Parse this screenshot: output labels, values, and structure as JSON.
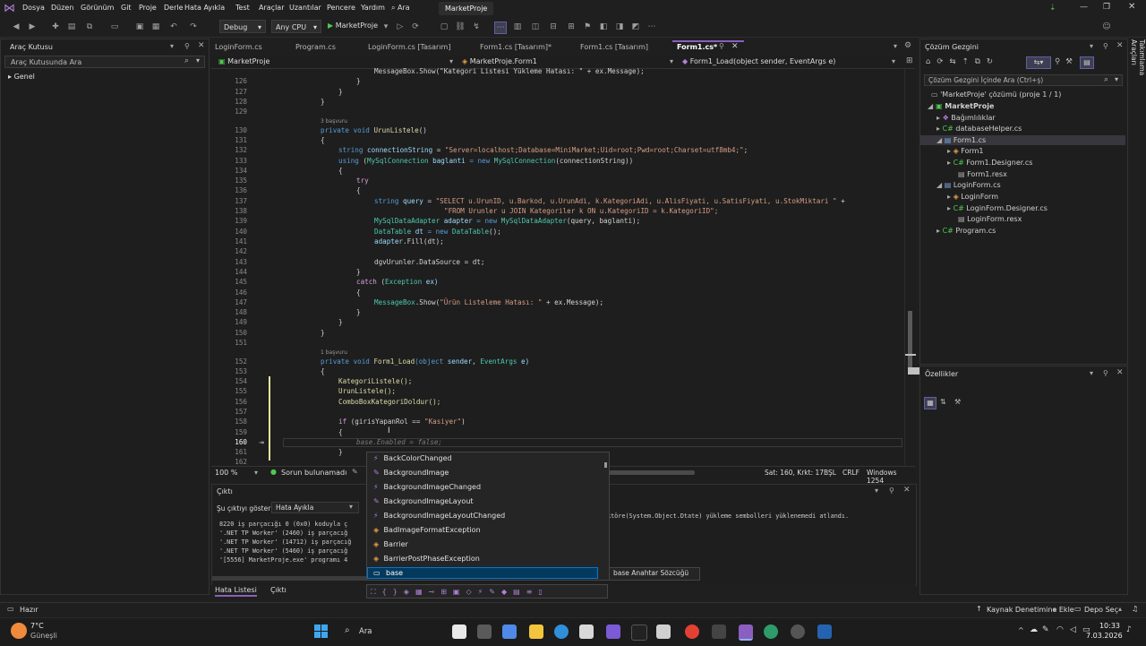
{
  "menubar": {
    "items": [
      "Dosya",
      "Düzen",
      "Görünüm",
      "Git",
      "Proje",
      "Derle",
      "Hata Ayıkla",
      "Test",
      "Araçlar",
      "Uzantılar",
      "Pencere",
      "Yardım"
    ],
    "search_label": "Ara",
    "solution_name": "MarketProje"
  },
  "toolbar": {
    "config": "Debug",
    "platform": "Any CPU",
    "run_label": "MarketProje"
  },
  "toolbox": {
    "title": "Araç Kutusu",
    "search_placeholder": "Araç Kutusunda Ara",
    "group": "Genel"
  },
  "tabs": [
    "LoginForm.cs",
    "Program.cs",
    "LoginForm.cs [Tasarım]",
    "Form1.cs [Tasarım]*",
    "Form1.cs [Tasarım]",
    "Form1.cs*"
  ],
  "navbar": {
    "project": "MarketProje",
    "class": "MarketProje.Form1",
    "member": "Form1_Load(object sender, EventArgs e)"
  },
  "editor": {
    "line_numbers": [
      "126",
      "127",
      "128",
      "129",
      "130",
      "131",
      "132",
      "133",
      "134",
      "135",
      "136",
      "137",
      "138",
      "139",
      "140",
      "141",
      "142",
      "143",
      "144",
      "145",
      "146",
      "147",
      "148",
      "149",
      "150",
      "151",
      "152",
      "153",
      "154",
      "155",
      "156",
      "157",
      "158",
      "159",
      "160",
      "161",
      "162"
    ],
    "ref_labels": [
      "3 başvuru",
      "1 başvuru"
    ],
    "lines": {
      "l125": "MessageBox.Show(\"Kategori Listesi Yükleme Hatası: \" + ex.Message);",
      "l126": "}",
      "l127": "}",
      "l128": "}",
      "l130a": "private void ",
      "l130b": "UrunListele",
      "l130c": "()",
      "l131": "{",
      "l132a": "string ",
      "l132b": "connectionString",
      "l132c": " = ",
      "l132d": "\"Server=localhost;Database=MiniMarket;Uid=root;Pwd=root;Charset=utf8mb4;\"",
      "l132e": ";",
      "l133a": "using ",
      "l133b": "(",
      "l133c": "MySqlConnection",
      "l133d": " baglanti",
      "l133e": " = new ",
      "l133f": "MySqlConnection",
      "l133g": "(connectionString))",
      "l134": "{",
      "l135": "try",
      "l136": "{",
      "l137a": "string ",
      "l137b": "query",
      "l137c": " = ",
      "l137d": "\"SELECT u.UrunID, u.Barkod, u.UrunAdi, k.KategoriAdi, u.AlisFiyati, u.SatisFiyati, u.StokMiktari \"",
      "l137e": " +",
      "l138": "\"FROM Urunler u JOIN Kategoriler k ON u.KategoriID = k.KategoriID\";",
      "l139a": "MySqlDataAdapter",
      "l139b": " adapter",
      "l139c": " = new ",
      "l139d": "MySqlDataAdapter",
      "l139e": "(query, baglanti);",
      "l140a": "DataTable",
      "l140b": " dt",
      "l140c": " = new ",
      "l140d": "DataTable",
      "l140e": "();",
      "l141a": "adapter",
      "l141b": ".Fill(dt);",
      "l143": "dgvUrunler.DataSource = dt;",
      "l144": "}",
      "l145a": "catch ",
      "l145b": "(",
      "l145c": "Exception",
      "l145d": " ex)",
      "l146": "{",
      "l147a": "MessageBox",
      "l147b": ".Show(",
      "l147c": "\"Ürün Listeleme Hatası: \"",
      "l147d": " + ex.Message);",
      "l148": "}",
      "l149": "}",
      "l150": "}",
      "l152a": "private void ",
      "l152b": "Form1_Load",
      "l152c": "(object ",
      "l152d": "sender",
      "l152e": ", ",
      "l152f": "EventArgs",
      "l152g": " e)",
      "l153": "{",
      "l154": "KategoriListele();",
      "l155": "UrunListele();",
      "l156": "ComboBoxKategoriDoldur();",
      "l158a": "if ",
      "l158b": "(girisYapanRol == ",
      "l158c": "\"Kasiyer\"",
      "l158d": ")",
      "l159": "{",
      "l160": "base.Enabled = false;",
      "l161": "}"
    }
  },
  "editor_status": {
    "zoom": "100 %",
    "issues": "Sorun bulunamadı",
    "position": "Sat: 160, Krkt: 17",
    "insert_mode": "BŞL",
    "line_end": "CRLF",
    "encoding": "Windows 1254"
  },
  "autocomplete": {
    "items": [
      "BackColorChanged",
      "BackgroundImage",
      "BackgroundImageChanged",
      "BackgroundImageLayout",
      "BackgroundImageLayoutChanged",
      "BadImageFormatException",
      "Barrier",
      "BarrierPostPhaseException",
      "base"
    ],
    "selected": "base",
    "tooltip": "base Anahtar Sözcüğü"
  },
  "solution_explorer": {
    "title": "Çözüm Gezgini",
    "search_placeholder": "Çözüm Gezgini İçinde Ara (Ctrl+ş)",
    "items": [
      {
        "label": "'MarketProje' çözümü (proje 1 / 1)",
        "bold": false
      },
      {
        "label": "MarketProje",
        "bold": true
      },
      {
        "label": "Bağımlılıklar",
        "bold": false
      },
      {
        "label": "databaseHelper.cs",
        "bold": false
      },
      {
        "label": "Form1.cs",
        "bold": false
      },
      {
        "label": "Form1",
        "bold": false
      },
      {
        "label": "Form1.Designer.cs",
        "bold": false
      },
      {
        "label": "Form1.resx",
        "bold": false
      },
      {
        "label": "LoginForm.cs",
        "bold": false
      },
      {
        "label": "LoginForm",
        "bold": false
      },
      {
        "label": "LoginForm.Designer.cs",
        "bold": false
      },
      {
        "label": "LoginForm.resx",
        "bold": false
      },
      {
        "label": "Program.cs",
        "bold": false
      }
    ]
  },
  "side_tab": "Takımlama Araçları",
  "properties": {
    "title": "Özellikler"
  },
  "output": {
    "title": "Çıktı",
    "show_label": "Şu çıktıyı göster:",
    "source": "Hata Ayıkla",
    "lines": [
      "8220 iş parçacığı 0 (0x0) koduyla ç",
      "'.NET TP Worker' (2460) iş parçacığ",
      "'.NET TP Worker' (14712) iş parçacığ",
      "'.NET TP Worker' (5460) iş parçacığ",
      "'[5556] MarketProje.exe' programı 4"
    ],
    "right_text": "ktöre(System.Object.Dtate) yükleme sembolleri yüklenemedi atlandı."
  },
  "bottom_tabs": [
    "Hata Listesi",
    "Çıktı"
  ],
  "statusbar": {
    "ready": "Hazır",
    "source_control": "Kaynak Denetimine Ekle",
    "repo": "Depo Seç"
  },
  "taskbar": {
    "weather_temp": "7°C",
    "weather_desc": "Güneşli",
    "search": "Ara",
    "time": "10:33",
    "date": "7.03.2026"
  },
  "colors": {
    "accent": "#8a5fbf",
    "statusbar": "#1f1f1f",
    "editor_bg": "#1e1e1e",
    "keyword": "#569cd6",
    "string": "#d69d85",
    "type": "#4ec9b0"
  }
}
